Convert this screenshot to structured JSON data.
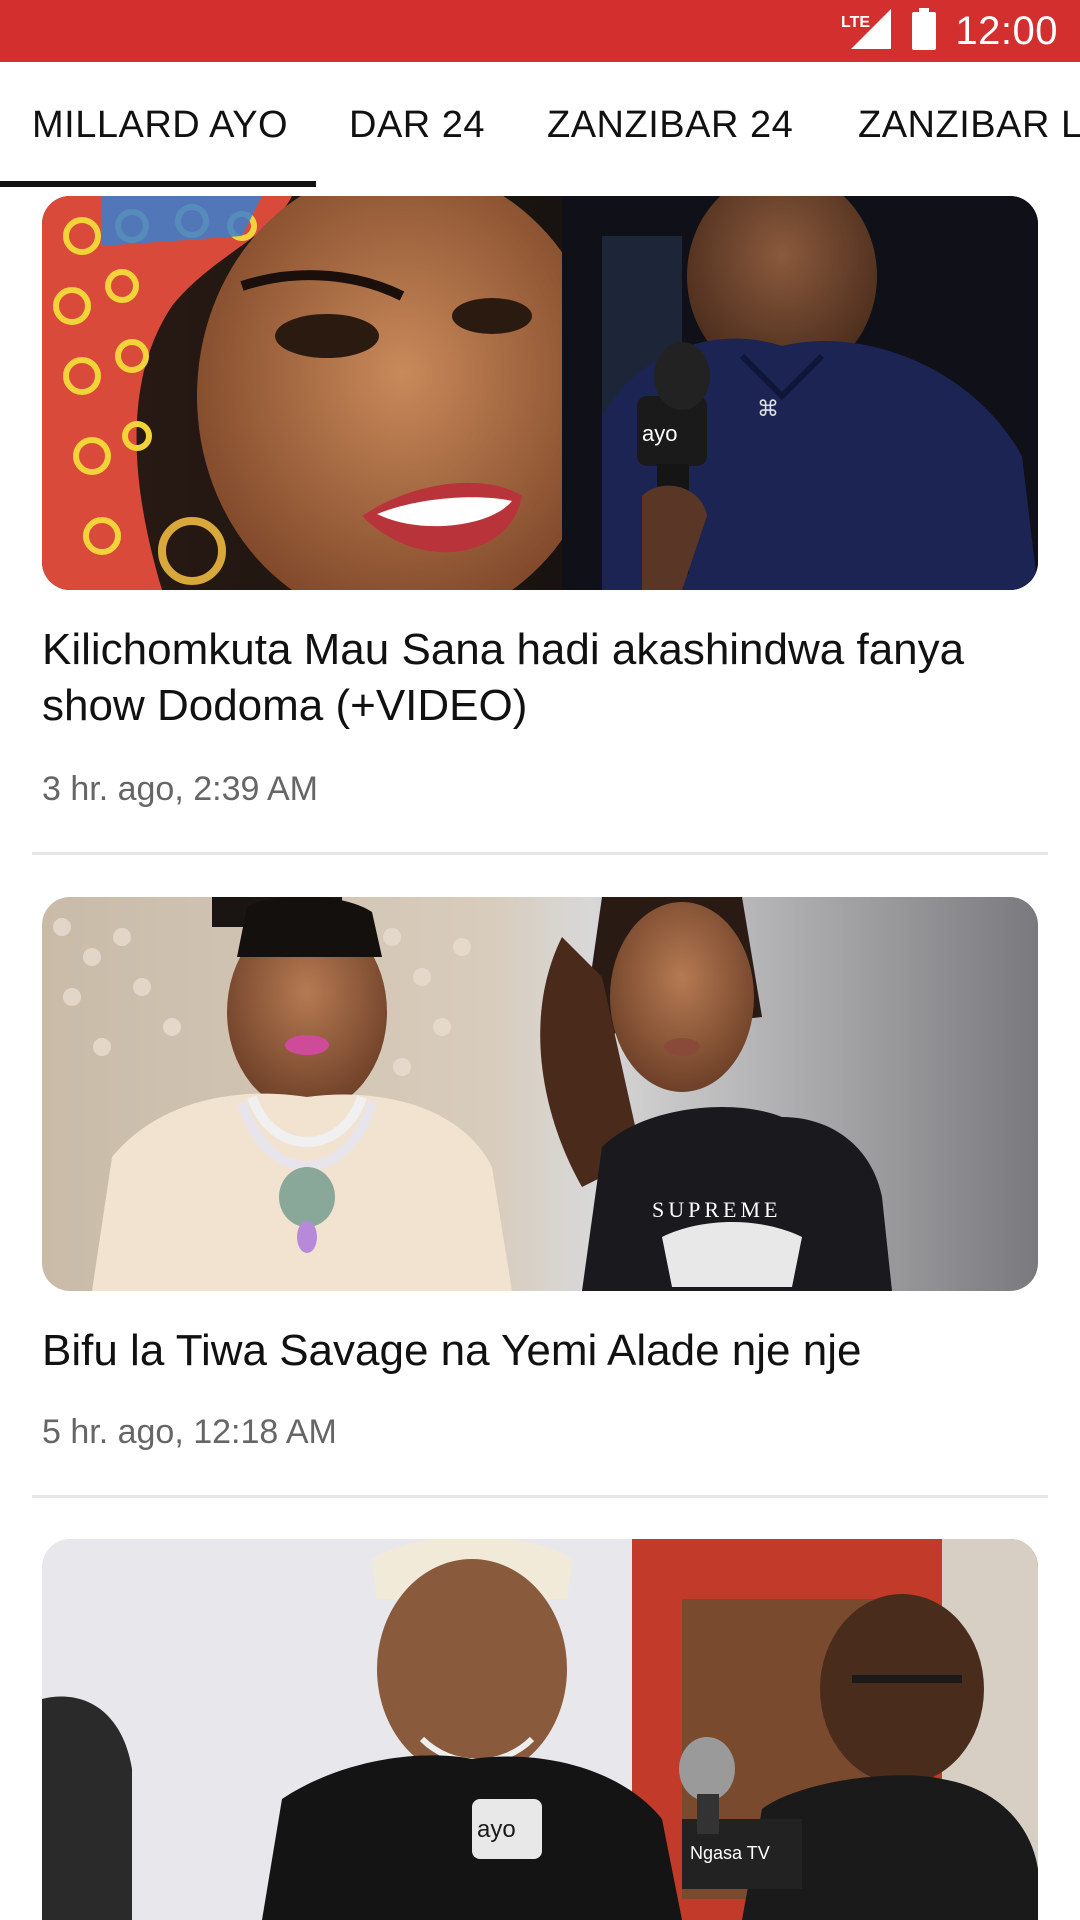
{
  "status_bar": {
    "network": "LTE",
    "time": "12:00",
    "background": "#d32f2f"
  },
  "tabs": [
    {
      "label": "MILLARD AYO",
      "selected": true
    },
    {
      "label": "DAR 24",
      "selected": false
    },
    {
      "label": "ZANZIBAR 24",
      "selected": false
    },
    {
      "label": "ZANZIBAR L",
      "selected": false
    }
  ],
  "articles": [
    {
      "title": "Kilichomkuta Mau Sana hadi akashindwa fanya show Dodoma (+VIDEO)",
      "time": "3 hr. ago, 2:39 AM",
      "image_logo": "ayo"
    },
    {
      "title": "Bifu la Tiwa Savage na Yemi Alade nje nje",
      "time": "5 hr. ago, 12:18 AM",
      "image_shirt_text": "SUPREME"
    },
    {
      "title": "",
      "time": "",
      "image_logo": "ayo",
      "image_logo_2": "Ngasa TV"
    }
  ],
  "icons": {
    "signal": "lte-signal-icon",
    "battery": "battery-icon"
  }
}
